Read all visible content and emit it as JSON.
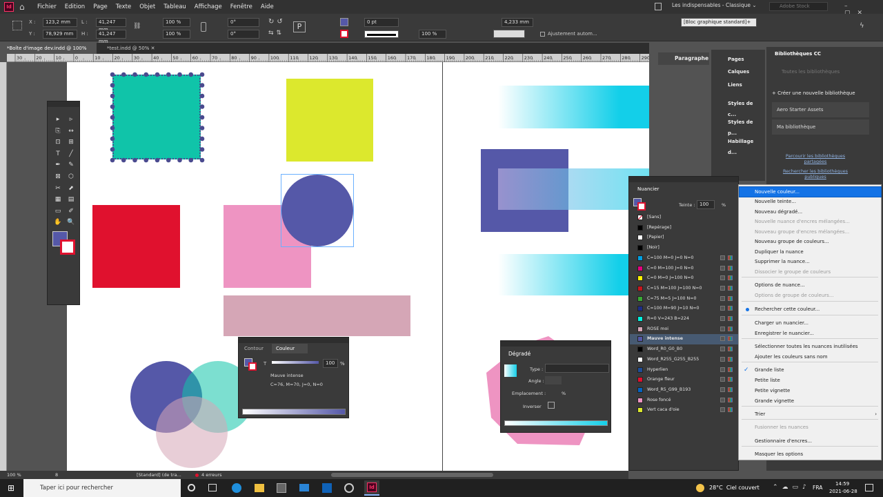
{
  "app": {
    "logo": "Id"
  },
  "menubar": {
    "items": [
      "Fichier",
      "Edition",
      "Page",
      "Texte",
      "Objet",
      "Tableau",
      "Affichage",
      "Fenêtre",
      "Aide"
    ],
    "workspace": "Les indispensables - Classique",
    "search_placeholder": "Adobe Stock"
  },
  "control": {
    "x_label": "X :",
    "x": "123,2 mm",
    "y_label": "Y :",
    "y": "78,929 mm",
    "w_label": "L :",
    "w": "41,247 mm",
    "h_label": "H :",
    "h": "41,247 mm",
    "scale_x": "100 %",
    "scale_y": "100 %",
    "angle": "0°",
    "shear": "0°",
    "stroke_weight": "0 pt",
    "opacity": "100 %",
    "size_mm": "4,233 mm",
    "autofit_label": "Ajustement autom...",
    "style": "[Bloc graphique standard]+"
  },
  "tabs": [
    {
      "label": "*Boîte d'image dev.indd @ 100%",
      "active": true
    },
    {
      "label": "*test.indd @ 50%",
      "active": false
    }
  ],
  "ruler": {
    "ticks": [
      "30",
      "20",
      "10",
      "0",
      "10",
      "20",
      "30",
      "40",
      "50",
      "60",
      "70",
      "80",
      "90",
      "100",
      "110",
      "120",
      "130",
      "140",
      "150",
      "160",
      "170",
      "180",
      "190",
      "200",
      "210",
      "220",
      "230",
      "240",
      "250",
      "260",
      "270",
      "280",
      "290"
    ]
  },
  "colors": {
    "teal": "#10c4a9",
    "yellow": "#dce82d",
    "violet": "#5558a8",
    "red": "#e0112e",
    "pink": "#ee94c2",
    "mauve": "#d5a6b6",
    "cyan": "#13cfe9",
    "dots": "#4a4a8f",
    "accent": "#1473e6"
  },
  "right_dock": {
    "items": [
      "Paragraphe"
    ]
  },
  "side_panels": {
    "items": [
      "Pages",
      "Calques",
      "Liens",
      "Styles de c...",
      "Styles de p...",
      "Habillage d..."
    ]
  },
  "cc_libraries": {
    "title": "Bibliothèques CC",
    "search_placeholder": "Toutes les bibliothèques",
    "create": "Créer une nouvelle bibliothèque",
    "libraries": [
      "Aero Starter Assets",
      "Ma bibliothèque"
    ],
    "browse": "Parcourir les bibliothèques partagées",
    "find": "Rechercher les bibliothèques publiques"
  },
  "swatches": {
    "title": "Nuancier",
    "tint_label": "Teinte :",
    "tint": "100",
    "percent": "%",
    "items": [
      {
        "name": "[Sans]",
        "color": "#ffffff"
      },
      {
        "name": "[Repérage]",
        "color": "#000000"
      },
      {
        "name": "[Papier]",
        "color": "#ffffff"
      },
      {
        "name": "[Noir]",
        "color": "#000000"
      },
      {
        "name": "C=100 M=0 J=0 N=0",
        "color": "#00a0e3"
      },
      {
        "name": "C=0 M=100 J=0 N=0",
        "color": "#e4007f"
      },
      {
        "name": "C=0 M=0 J=100 N=0",
        "color": "#fff100"
      },
      {
        "name": "C=15 M=100 J=100 N=0",
        "color": "#c8161d"
      },
      {
        "name": "C=75 M=5 J=100 N=0",
        "color": "#3aa935"
      },
      {
        "name": "C=100 M=90 J=10 N=0",
        "color": "#1d2d88"
      },
      {
        "name": "R=0 V=243 B=224",
        "color": "#00f3e0"
      },
      {
        "name": "ROSE moi",
        "color": "#d5a6b6"
      },
      {
        "name": "Mauve intense",
        "color": "#5558a8",
        "selected": true
      },
      {
        "name": "Word_R0_G0_B0",
        "color": "#000000"
      },
      {
        "name": "Word_R255_G255_B255",
        "color": "#ffffff"
      },
      {
        "name": "Hyperlien",
        "color": "#1f4e99"
      },
      {
        "name": "Orange fleur",
        "color": "#e0112e"
      },
      {
        "name": "Word_R5_G99_B193",
        "color": "#0563c1"
      },
      {
        "name": "Rose foncé",
        "color": "#ee94c2"
      },
      {
        "name": "Vert caca d'oie",
        "color": "#dce82d"
      }
    ]
  },
  "context_menu": {
    "items": [
      {
        "label": "Nouvelle couleur...",
        "highlight": true
      },
      {
        "label": "Nouvelle teinte..."
      },
      {
        "label": "Nouveau dégradé..."
      },
      {
        "label": "Nouvelle nuance d'encres mélangées...",
        "disabled": true
      },
      {
        "label": "Nouveau groupe d'encres mélangées...",
        "disabled": true
      },
      {
        "label": "Nouveau groupe de couleurs..."
      },
      {
        "label": "Dupliquer la nuance"
      },
      {
        "label": "Supprimer la nuance..."
      },
      {
        "label": "Dissocier le groupe de couleurs",
        "disabled": true
      },
      {
        "label": "Options de nuance..."
      },
      {
        "label": "Options de groupe de couleurs...",
        "disabled": true
      },
      {
        "label": "Rechercher cette couleur..."
      },
      {
        "label": "Charger un nuancier..."
      },
      {
        "label": "Enregistrer le nuancier..."
      },
      {
        "label": "Sélectionner toutes les nuances inutilisées"
      },
      {
        "label": "Ajouter les couleurs sans nom"
      },
      {
        "label": "Grande liste"
      },
      {
        "label": "Petite liste"
      },
      {
        "label": "Petite vignette"
      },
      {
        "label": "Grande vignette"
      },
      {
        "label": "Trier"
      },
      {
        "label": "Fusionner les nuances",
        "disabled": true
      },
      {
        "label": "Gestionnaire d'encres..."
      },
      {
        "label": "Masquer les options"
      }
    ]
  },
  "color_panel": {
    "tab_stroke": "Contour",
    "tab_color": "Couleur",
    "value": "100",
    "percent": "%",
    "name": "Mauve intense",
    "formula": "C=76, M=70, J=0, N=0",
    "t_label": "T"
  },
  "gradient_panel": {
    "title": "Dégradé",
    "type_label": "Type :",
    "angle_label": "Angle :",
    "location_label": "Emplacement :",
    "percent": "%",
    "reverse_label": "Inverser"
  },
  "status": {
    "zoom": "100 %",
    "page": "8",
    "style": "[Standard] (de tra...",
    "errors": "4 erreurs"
  },
  "taskbar": {
    "search_placeholder": "Taper ici pour rechercher",
    "weather": "28°C  Ciel couvert",
    "lang": "FRA",
    "time": "14:59",
    "date": "2021-06-28"
  }
}
